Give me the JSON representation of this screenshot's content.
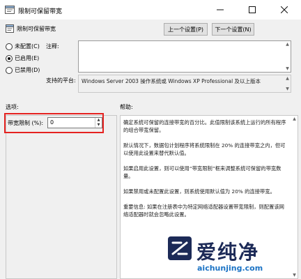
{
  "window": {
    "title": "限制可保留带宽"
  },
  "header": {
    "policy_name": "限制可保留带宽",
    "prev_button": "上一个设置(P)",
    "next_button": "下一个设置(N)"
  },
  "state_options": [
    {
      "label": "未配置(C)",
      "selected": false
    },
    {
      "label": "已启用(E)",
      "selected": true
    },
    {
      "label": "已禁用(D)",
      "selected": false
    }
  ],
  "comment": {
    "label": "注释:",
    "value": ""
  },
  "supported_on": {
    "label": "支持的平台:",
    "value": "Windows Server 2003 操作系统或 Windows XP Professional 及以上版本"
  },
  "options": {
    "header": "选项:",
    "bandwidth_limit": {
      "label": "带宽限制 (%):",
      "value": "0"
    }
  },
  "help": {
    "header": "帮助:",
    "paragraphs": [
      "确定系统可保留的连接带宽的百分比。此值限制该系统上运行的所有程序的组合带宽保留。",
      "默认情况下，数据包计划程序将系统限制在 20% 的连接带宽之内，但可以使用此设置来替代默认值。",
      "如果启用此设置，则可以使用“带宽限制”框来调整系统可保留的带宽数量。",
      "如果禁用或未配置此设置，则系统使用默认值为 20% 的连接带宽。",
      "重要信息: 如果在注册表中为特定网络适配器设置带宽限制，则配置该网络适配器时就会忽略此设置。"
    ]
  },
  "watermark": {
    "brand": "爱纯净",
    "url": "aichunjing.com"
  },
  "colors": {
    "highlight": "#e52220",
    "watermark_text": "#1c2a57",
    "watermark_url": "#1b73c5"
  }
}
